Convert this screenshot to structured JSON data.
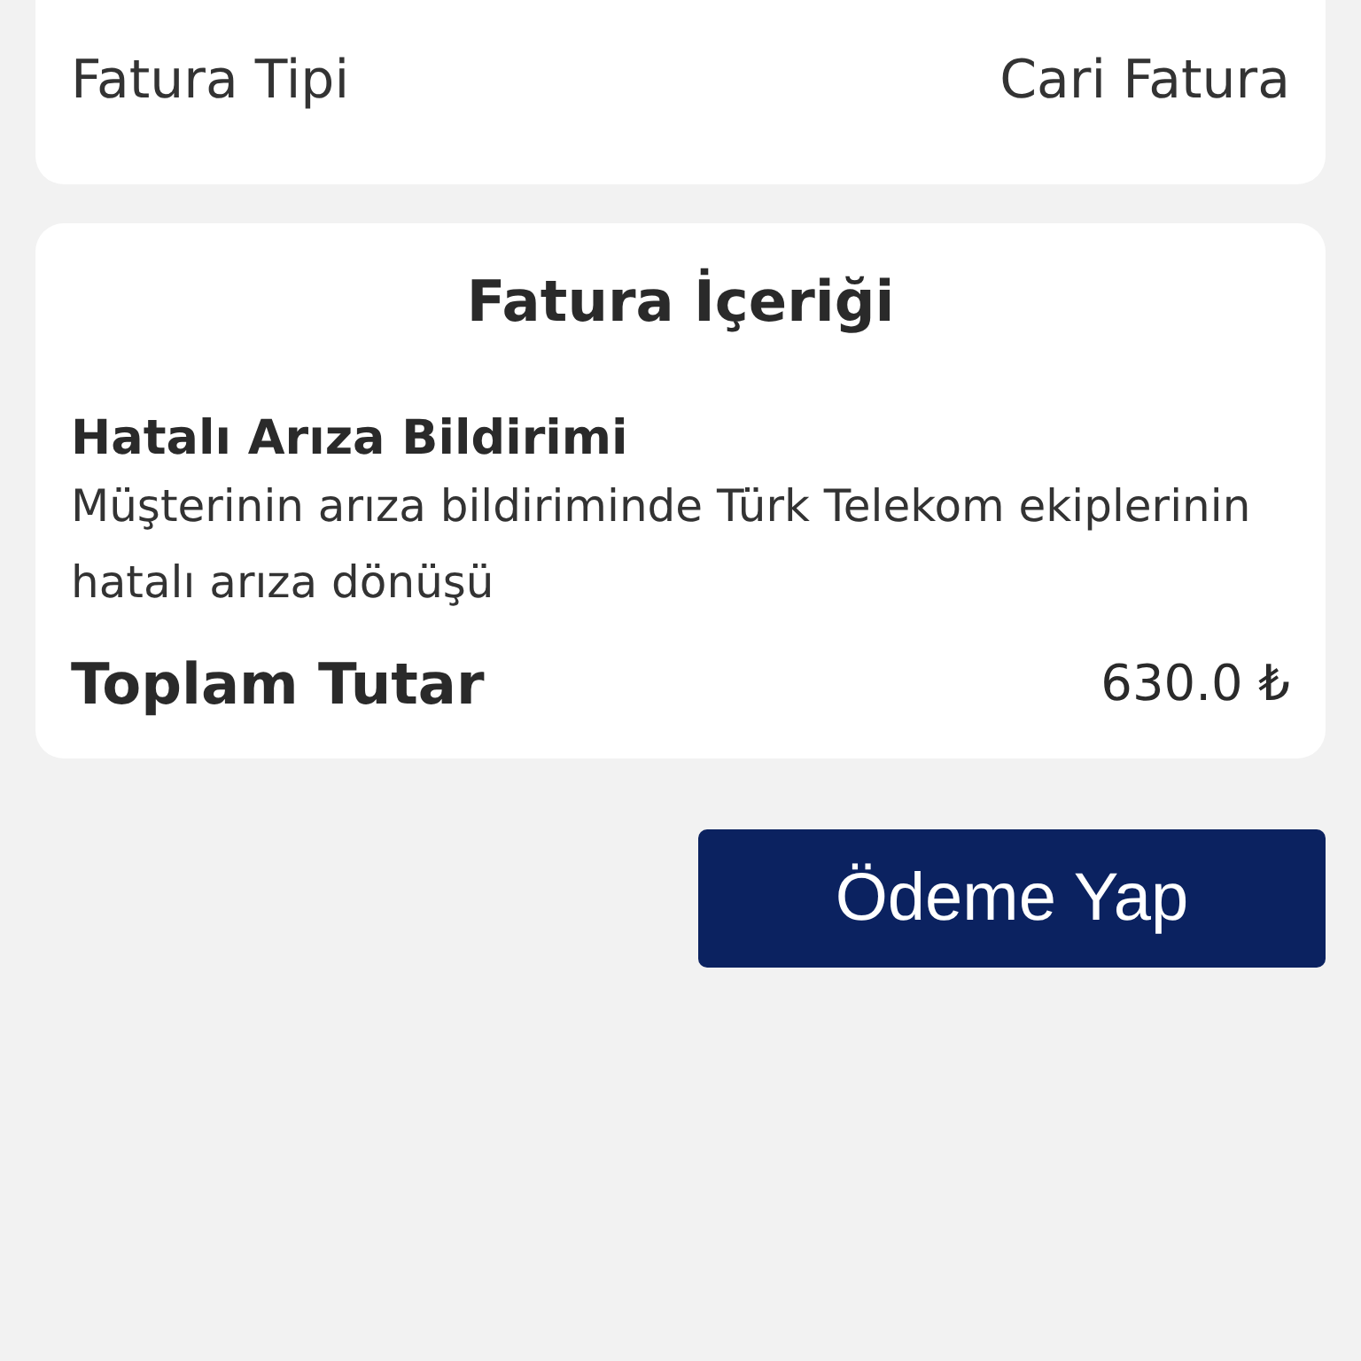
{
  "invoice_type": {
    "label": "Fatura Tipi",
    "value": "Cari Fatura"
  },
  "invoice_content": {
    "title": "Fatura İçeriği",
    "item_title": "Hatalı Arıza Bildirimi",
    "item_description": "Müşterinin arıza bildiriminde Türk Telekom ekiplerinin hatalı arıza dönüşü",
    "total_label": "Toplam Tutar",
    "total_value": "630.0 ₺"
  },
  "pay_button": {
    "label": "Ödeme Yap"
  }
}
